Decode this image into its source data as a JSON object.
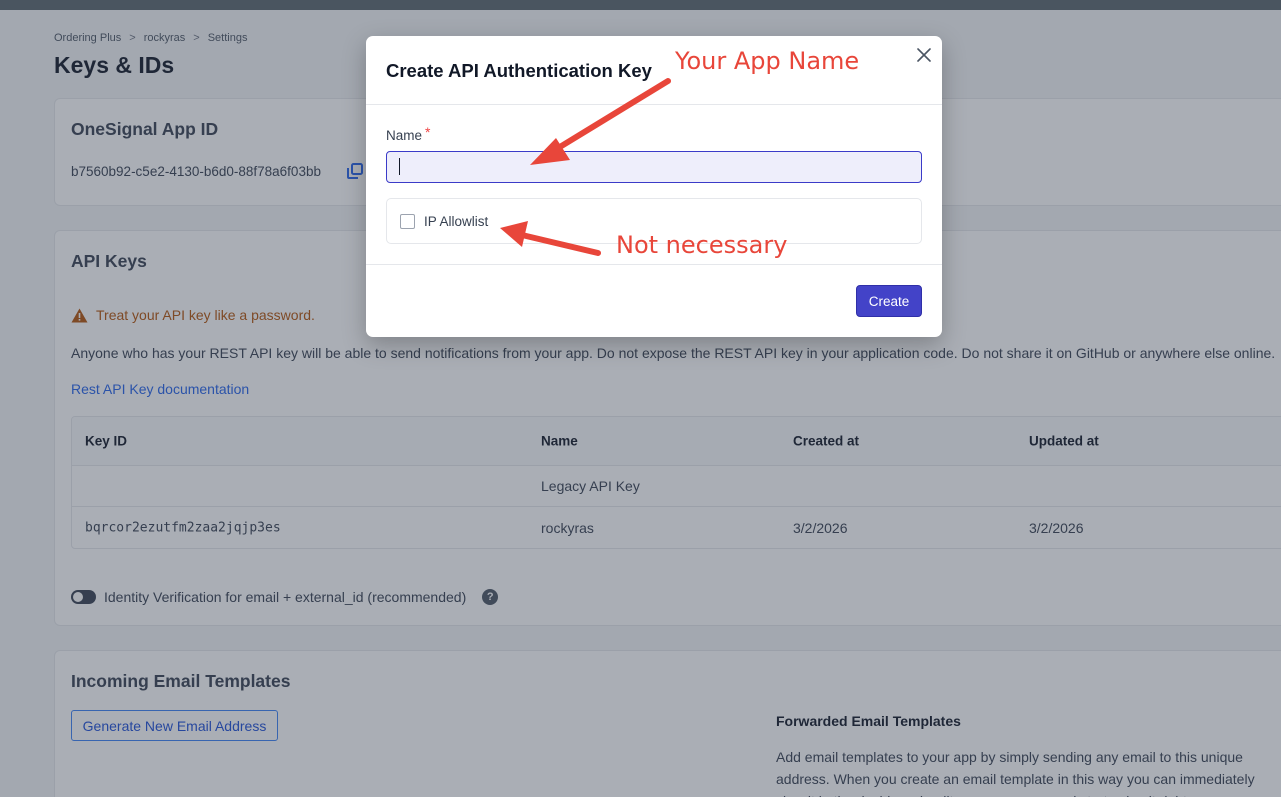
{
  "breadcrumb": {
    "items": [
      "Ordering Plus",
      "rockyras",
      "Settings"
    ],
    "separator": ">"
  },
  "page_title": "Keys & IDs",
  "app_id_card": {
    "title": "OneSignal App ID",
    "value": "b7560b92-c5e2-4130-b6d0-88f78a6f03bb",
    "copy_icon": "copy-icon"
  },
  "api_keys_card": {
    "title": "API Keys",
    "warning": "Treat your API key like a password.",
    "description": "Anyone who has your REST API key will be able to send notifications from your app. Do not expose the REST API key in your application code. Do not share it on GitHub or anywhere else online.",
    "doc_link": "Rest API Key documentation",
    "table": {
      "headers": [
        "Key ID",
        "Name",
        "Created at",
        "Updated at"
      ],
      "rows": [
        [
          "",
          "Legacy API Key",
          "",
          ""
        ],
        [
          "bqrcor2ezutfm2zaa2jqjp3es",
          "rockyras",
          "3/2/2026",
          "3/2/2026"
        ]
      ]
    },
    "identity_verification": "Identity Verification for email + external_id (recommended)",
    "help_icon": "?"
  },
  "email_card": {
    "title": "Incoming Email Templates",
    "generate_button": "Generate New Email Address",
    "forwarded_title": "Forwarded Email Templates",
    "forwarded_desc": "Add email templates to your app by simply sending any email to this unique address. When you create an email template in this way you can immediately view it in the dashboard, edit any resources, and start using it right away."
  },
  "modal": {
    "title": "Create API Authentication Key",
    "name_label": "Name",
    "required_mark": "*",
    "name_value": "",
    "ip_allowlist_label": "IP Allowlist",
    "ip_allowlist_checked": false,
    "create_button": "Create",
    "close_icon": "close-icon"
  },
  "annotations": {
    "app_name": "Your App Name",
    "not_necessary": "Not necessary"
  },
  "colors": {
    "accent": "#4343c8",
    "annotation": "#e8463a",
    "warning": "#b45309",
    "link": "#2563eb"
  }
}
